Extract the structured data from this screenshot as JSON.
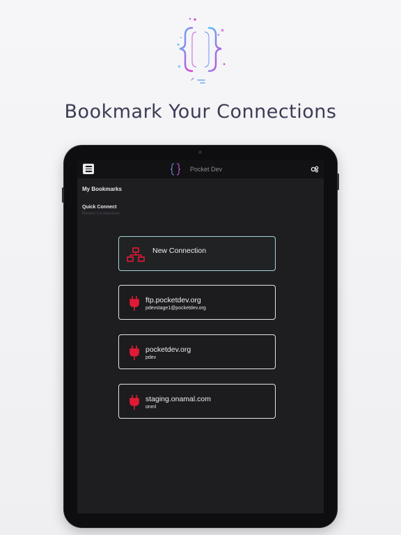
{
  "headline": "Bookmark Your Connections",
  "app": {
    "title": "Pocket Dev"
  },
  "bookmarks": {
    "title": "My Bookmarks",
    "quick_connect": "Quick Connect",
    "recent_connections": "Recent Connections"
  },
  "new_connection": {
    "label": "New Connection",
    "icon": "network-icon"
  },
  "connections": [
    {
      "host": "ftp.pocketdev.org",
      "user": "pdevstage1@pocketdev.org",
      "icon": "plug-icon"
    },
    {
      "host": "pocketdev.org",
      "user": "pdev",
      "icon": "plug-icon"
    },
    {
      "host": "staging.onamal.com",
      "user": "onml",
      "icon": "plug-icon"
    }
  ],
  "colors": {
    "accent_red": "#e01a36",
    "logo_gradient_start": "#4fc3f7",
    "logo_gradient_end": "#d63ad9",
    "card_border": "#e4e4ea",
    "new_connection_border": "#a8d4dc",
    "screen_background": "#1e1e20"
  }
}
